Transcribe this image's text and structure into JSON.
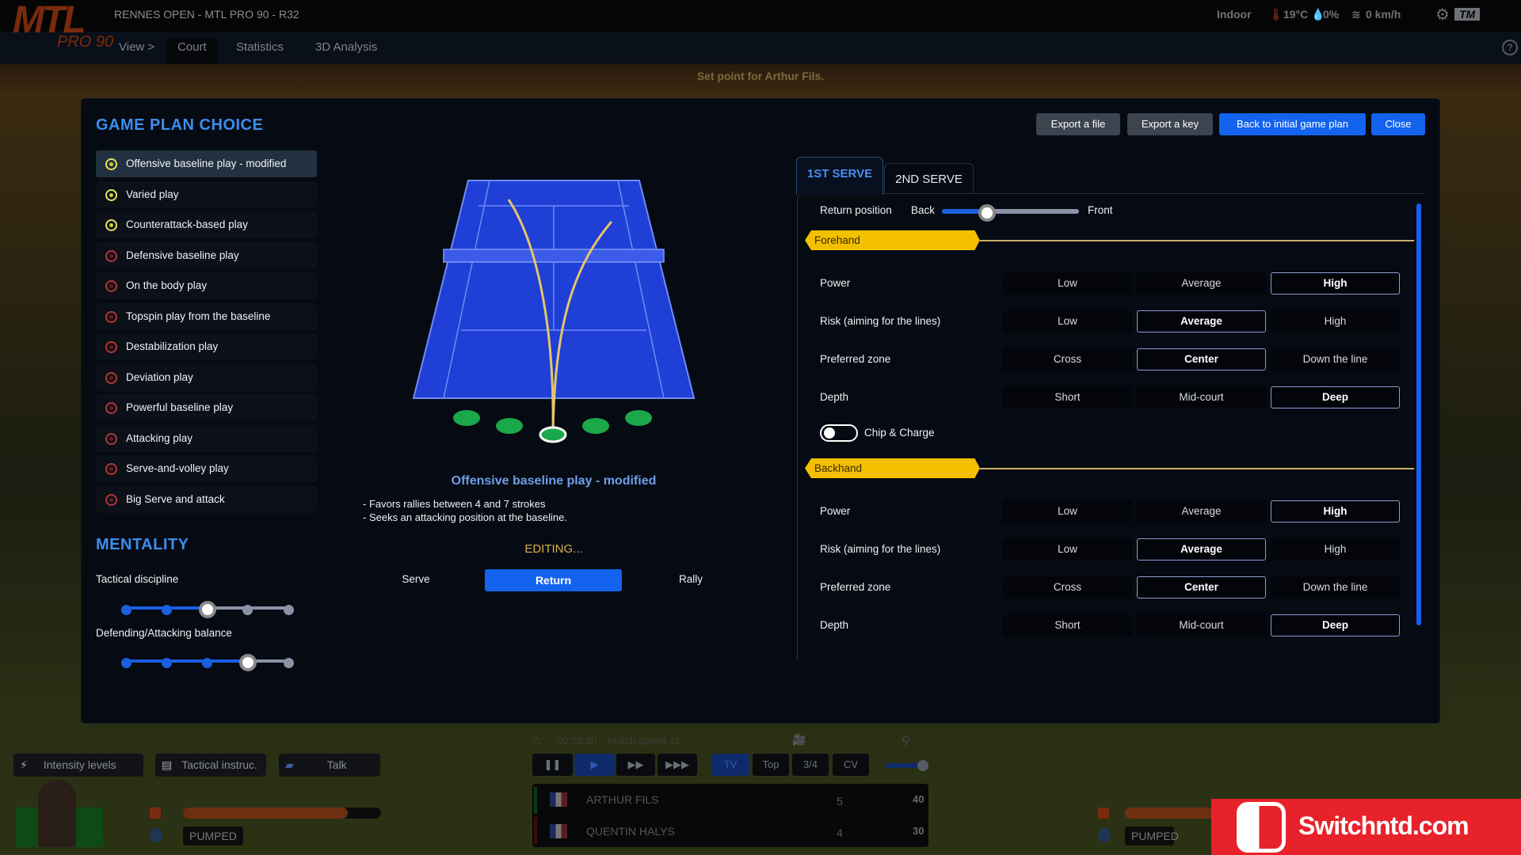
{
  "app": {
    "title": "RENNES OPEN - MTL PRO 90 - R32",
    "logo": "MTL",
    "logo_sub": "PRO 90"
  },
  "nav": {
    "view": "View >",
    "items": [
      "Court",
      "Statistics",
      "3D Analysis"
    ],
    "active": "Court"
  },
  "weather": {
    "venue": "Indoor",
    "temperature": "19°C",
    "humidity": "0%",
    "wind": "0 km/h",
    "brand": "TM"
  },
  "banner": "Set point for Arthur Fils.",
  "modal": {
    "title": "GAME PLAN CHOICE",
    "buttons": {
      "export_file": "Export a file",
      "export_key": "Export a key",
      "back": "Back to initial game plan",
      "close": "Close"
    },
    "plans": [
      {
        "label": "Offensive baseline play - modified",
        "status": "yellow",
        "selected": true
      },
      {
        "label": "Varied play",
        "status": "yellow"
      },
      {
        "label": "Counterattack-based play",
        "status": "yellow"
      },
      {
        "label": "Defensive baseline play",
        "status": "red"
      },
      {
        "label": "On the body play",
        "status": "red"
      },
      {
        "label": "Topspin play from the baseline",
        "status": "red"
      },
      {
        "label": "Destabilization play",
        "status": "red"
      },
      {
        "label": "Deviation play",
        "status": "red"
      },
      {
        "label": "Powerful baseline play",
        "status": "red"
      },
      {
        "label": "Attacking play",
        "status": "red"
      },
      {
        "label": "Serve-and-volley play",
        "status": "red"
      },
      {
        "label": "Big Serve and attack",
        "status": "red"
      }
    ],
    "mentality": {
      "title": "MENTALITY",
      "sliders": [
        {
          "label": "Tactical discipline",
          "value": 3,
          "max": 5
        },
        {
          "label": "Defending/Attacking balance",
          "value": 4,
          "max": 5
        }
      ]
    },
    "plan_detail": {
      "name": "Offensive baseline play - modified",
      "bullets": [
        "- Favors rallies between 4 and 7 strokes",
        "- Seeks an attacking position at the baseline."
      ],
      "editing": "EDITING...",
      "modes": [
        "Serve",
        "Return",
        "Rally"
      ],
      "active_mode": "Return"
    },
    "tabs": [
      "1ST SERVE",
      "2ND SERVE"
    ],
    "active_tab": "1ST SERVE",
    "return_position": {
      "label": "Return position",
      "min_label": "Back",
      "max_label": "Front",
      "value": 0.33
    },
    "sections": [
      {
        "title": "Forehand",
        "rows": [
          {
            "label": "Power",
            "options": [
              "Low",
              "Average",
              "High"
            ],
            "selected": "High"
          },
          {
            "label": "Risk (aiming for the lines)",
            "options": [
              "Low",
              "Average",
              "High"
            ],
            "selected": "Average"
          },
          {
            "label": "Preferred zone",
            "options": [
              "Cross",
              "Center",
              "Down the line"
            ],
            "selected": "Center"
          },
          {
            "label": "Depth",
            "options": [
              "Short",
              "Mid-court",
              "Deep"
            ],
            "selected": "Deep"
          }
        ],
        "toggle": {
          "label": "Chip & Charge",
          "on": false
        }
      },
      {
        "title": "Backhand",
        "rows": [
          {
            "label": "Power",
            "options": [
              "Low",
              "Average",
              "High"
            ],
            "selected": "High"
          },
          {
            "label": "Risk (aiming for the lines)",
            "options": [
              "Low",
              "Average",
              "High"
            ],
            "selected": "Average"
          },
          {
            "label": "Preferred zone",
            "options": [
              "Cross",
              "Center",
              "Down the line"
            ],
            "selected": "Center"
          },
          {
            "label": "Depth",
            "options": [
              "Short",
              "Mid-court",
              "Deep"
            ],
            "selected": "Deep"
          }
        ]
      }
    ]
  },
  "hud": {
    "buttons": [
      "Intensity levels",
      "Tactical instruc.",
      "Talk"
    ],
    "time": "00:33:30",
    "speed": "Match speed x1",
    "cameras": [
      "TV",
      "Top",
      "3/4",
      "CV"
    ],
    "active_camera": "TV",
    "players": [
      {
        "name": "ARTHUR FILS",
        "games": "5",
        "points": "40"
      },
      {
        "name": "QUENTIN HALYS",
        "games": "4",
        "points": "30"
      }
    ],
    "left_mood": "PUMPED",
    "right_mood": "PUMPED",
    "left_energy": 0.83
  },
  "watermark": "Switchntd.com",
  "colors": {
    "accent": "#1463ee",
    "title": "#3d8df0",
    "banner": "#f2c000",
    "court": "#1f3fd6"
  }
}
